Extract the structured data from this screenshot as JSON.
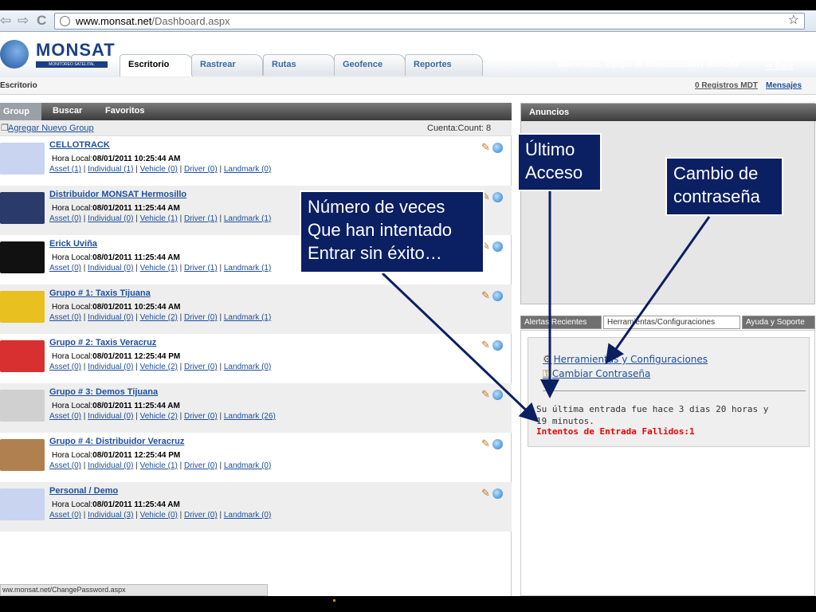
{
  "browser": {
    "url_domain": "www.monsat.net",
    "url_path": "/Dashboard.aspx",
    "back": "⇦",
    "forward": "⇨",
    "reload": "C"
  },
  "header": {
    "logo_text": "MONSAT",
    "logo_sub": "MONITOREO SATELITAL",
    "tabs": [
      {
        "label": "Escritorio"
      },
      {
        "label": "Rastrear"
      },
      {
        "label": "Rutas"
      },
      {
        "label": "Geofence"
      },
      {
        "label": "Reportes"
      }
    ],
    "welcome": "Bienvenido, Equipo de Demostración / MONSAT",
    "logout": "Salir"
  },
  "subbar": {
    "left": "Escritorio",
    "registros": "0 Registros MDT",
    "mensajes": "Mensajes"
  },
  "left": {
    "tabs": [
      "Group",
      "Buscar",
      "Favoritos"
    ],
    "add_group": "Agregar Nuevo Group",
    "count": "Cuenta:Count: 8",
    "time_label": "Hora Local:",
    "groups": [
      {
        "name": "CELLOTRACK",
        "time": "08/01/2011 10:25:44 AM",
        "links": [
          "Asset (1)",
          "Individual (1)",
          "Vehicle (0)",
          "Driver (0)",
          "Landmark (0)"
        ],
        "thumb_color": "#c8d4f0"
      },
      {
        "name": "Distribuidor MONSAT Hermosillo",
        "time": "08/01/2011 11:25:44 AM",
        "links": [
          "Asset (0)",
          "Individual (0)",
          "Vehicle (1)",
          "Driver (1)",
          "Landmark (1)"
        ],
        "thumb_color": "#2a3a6a"
      },
      {
        "name": "Erick Uviña",
        "time": "08/01/2011 11:25:44 AM",
        "links": [
          "Asset (0)",
          "Individual (0)",
          "Vehicle (1)",
          "Driver (1)",
          "Landmark (1)"
        ],
        "thumb_color": "#111111"
      },
      {
        "name": "Grupo # 1: Taxis Tijuana",
        "time": "08/01/2011 10:25:44 AM",
        "links": [
          "Asset (0)",
          "Individual (0)",
          "Vehicle (2)",
          "Driver (0)",
          "Landmark (1)"
        ],
        "thumb_color": "#e8c020"
      },
      {
        "name": "Grupo # 2: Taxis Veracruz",
        "time": "08/01/2011 12:25:44 PM",
        "links": [
          "Asset (0)",
          "Individual (0)",
          "Vehicle (2)",
          "Driver (0)",
          "Landmark (0)"
        ],
        "thumb_color": "#d83030"
      },
      {
        "name": "Grupo # 3: Demos Tijuana",
        "time": "08/01/2011 11:25:44 AM",
        "links": [
          "Asset (0)",
          "Individual (0)",
          "Vehicle (2)",
          "Driver (0)",
          "Landmark (26)"
        ],
        "thumb_color": "#d0d0d0"
      },
      {
        "name": "Grupo # 4: Distribuidor Veracruz",
        "time": "08/01/2011 12:25:44 PM",
        "links": [
          "Asset (0)",
          "Individual (0)",
          "Vehicle (1)",
          "Driver (0)",
          "Landmark (0)"
        ],
        "thumb_color": "#b08050"
      },
      {
        "name": "Personal / Demo",
        "time": "08/01/2011 11:25:44 AM",
        "links": [
          "Asset (0)",
          "Individual (3)",
          "Vehicle (0)",
          "Driver (0)",
          "Landmark (0)"
        ],
        "thumb_color": "#c8d4f0"
      }
    ]
  },
  "status_bar": "ww.monsat.net/ChangePassword.aspx",
  "right": {
    "anuncios": "Anuncios",
    "tabs": [
      "Alertas Recientes",
      "Herramientas/Configuraciones",
      "Ayuda y Soporte"
    ],
    "tool_link1": "Herramientas y Configuraciones",
    "tool_link2": "Cambiar Contraseña",
    "last_login": "Su última entrada fue hace 3 dias 20 horas y 19 minutos.",
    "failed": "Intentos de Entrada Fallidos:1"
  },
  "callouts": {
    "intentos": "Número de veces Que han intentado Entrar sin éxito…",
    "ultimo": "Último Acceso",
    "cambio": "Cambio de contraseña"
  }
}
